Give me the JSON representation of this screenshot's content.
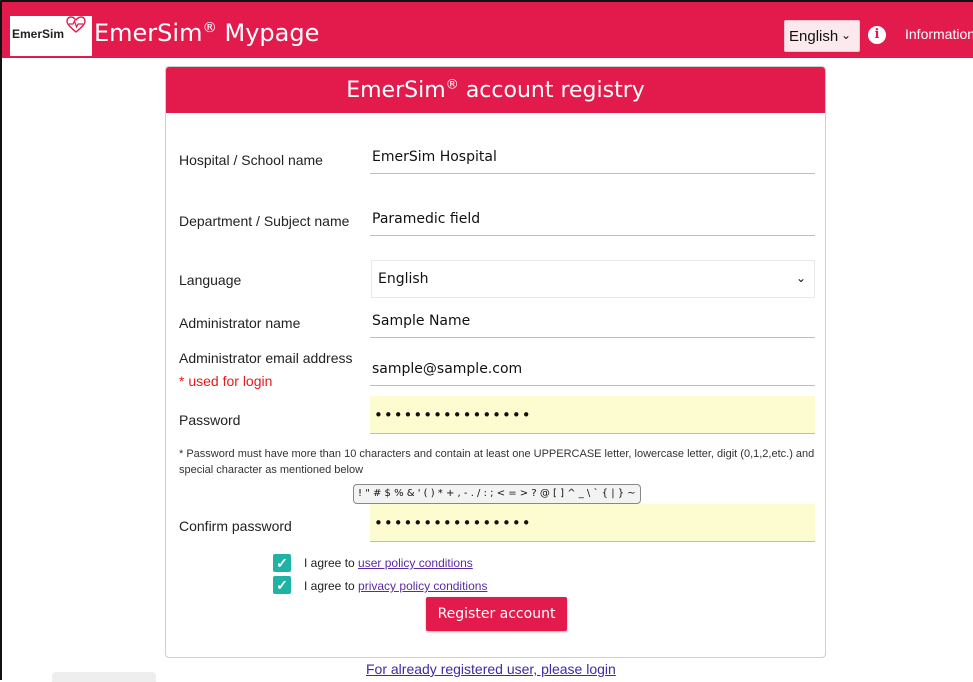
{
  "header": {
    "brand_small": "EmerSim",
    "brand_title": "EmerSim",
    "brand_title_suffix": "Mypage",
    "registered_mark": "®",
    "language": "English",
    "info_label": "Information",
    "accent_color": "#e31b4c"
  },
  "form": {
    "title": "EmerSim",
    "title_suffix": "account registry",
    "hospital": {
      "label": "Hospital / School name",
      "value": "EmerSim Hospital"
    },
    "department": {
      "label": "Department / Subject name",
      "value": "Paramedic field"
    },
    "language": {
      "label": "Language",
      "value": "English"
    },
    "admin_name": {
      "label": "Administrator name",
      "value": "Sample Name"
    },
    "admin_email": {
      "label": "Administrator email address",
      "note": "* used for login",
      "value": "sample@sample.com"
    },
    "password": {
      "label": "Password",
      "value": "••••••••••••••••"
    },
    "password_hint": "* Password must have more than 10 characters and contain at least one UPPERCASE letter, lowercase letter, digit (0,1,2,etc.) and special character as mentioned below",
    "special_chars": "! \" # $ % & ' ( ) * + , - . / : ; < = > ? @ [ ] ^ _ \\ ` { | } ~",
    "confirm_password": {
      "label": "Confirm password",
      "value": "••••••••••••••••"
    },
    "agree_user_prefix": "I agree to",
    "agree_user_link": "user policy conditions",
    "agree_privacy_prefix": "I agree to",
    "agree_privacy_link": "privacy policy conditions",
    "register_button": "Register account"
  },
  "footer": {
    "login_link": "For already registered user, please login"
  },
  "icons": {
    "heart": "heart-pulse-icon",
    "info": "info-icon",
    "chevron": "chevron-down-icon",
    "check": "check-icon"
  }
}
